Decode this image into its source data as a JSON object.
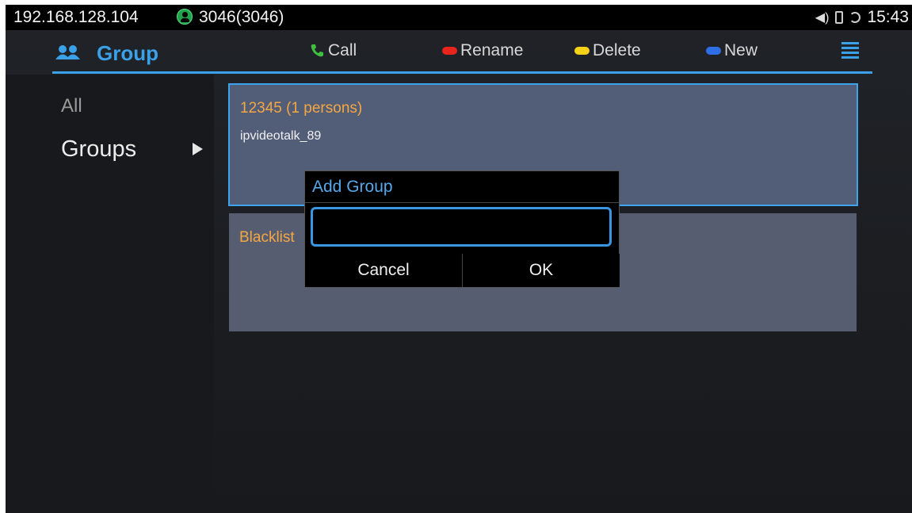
{
  "status_bar": {
    "ip": "192.168.128.104",
    "account": "3046(3046)",
    "time": "15:43"
  },
  "header": {
    "title": "Group",
    "actions": [
      {
        "label": "Call",
        "color": "#3fbf3f"
      },
      {
        "label": "Rename",
        "color": "#e8241c"
      },
      {
        "label": "Delete",
        "color": "#f5d21a"
      },
      {
        "label": "New",
        "color": "#2f6fe6"
      }
    ]
  },
  "sidebar": {
    "items": [
      {
        "label": "All"
      },
      {
        "label": "Groups"
      }
    ]
  },
  "groups": [
    {
      "title": "12345 (1 persons)",
      "member": "ipvideotalk_89"
    },
    {
      "title": "Blacklist"
    }
  ],
  "dialog": {
    "title": "Add Group",
    "input_value": "",
    "cancel_label": "Cancel",
    "ok_label": "OK"
  }
}
